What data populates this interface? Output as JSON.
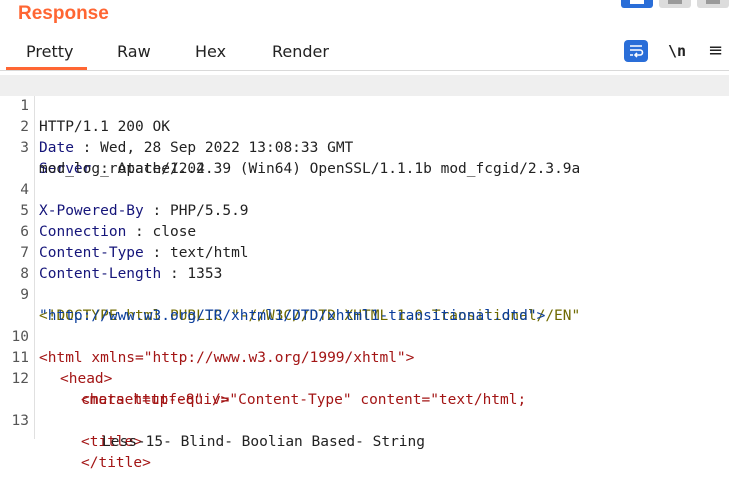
{
  "panel": {
    "title": "Response"
  },
  "tabs": [
    "Pretty",
    "Raw",
    "Hex",
    "Render"
  ],
  "toolbar": {
    "newline_label": "\\n",
    "menu_label": "≡"
  },
  "lines": [
    {
      "num": "1",
      "text": "HTTP/1.1 200 OK"
    },
    {
      "num": "2",
      "key": "Date",
      "value": "Wed, 28 Sep 2022 13:08:33 GMT"
    },
    {
      "num": "3",
      "key": "Server",
      "value": "Apache/2.4.39 (Win64) OpenSSL/1.1.1b mod_fcgid/2.3.9a",
      "cont": "mod_log_rotate/1.02"
    },
    {
      "num": "4",
      "key": "X-Powered-By",
      "value": "PHP/5.5.9"
    },
    {
      "num": "5",
      "key": "Connection",
      "value": "close"
    },
    {
      "num": "6",
      "key": "Content-Type",
      "value": "text/html"
    },
    {
      "num": "7",
      "key": "Content-Length",
      "value": "1353"
    },
    {
      "num": "8",
      "text": ""
    },
    {
      "num": "9",
      "text": "<!DOCTYPE html PUBLIC \"-//W3C//DTD XHTML 1.0 Transitional//EN\"",
      "cont": "\"http://www.w3.org/TR/xhtml1/DTD/xhtml1-transitional.dtd\">"
    },
    {
      "num": "10",
      "text": "<html xmlns=\"http://www.w3.org/1999/xhtml\">"
    },
    {
      "num": "11",
      "text": "<head>"
    },
    {
      "num": "12",
      "text": "<meta http-equiv=\"Content-Type\" content=\"text/html;",
      "cont": "charset=utf-8\" />"
    },
    {
      "num": "13",
      "text": "<title>",
      "cont": "Less-15- Blind- Boolian Based- String"
    },
    {
      "num": "",
      "text": "</title>"
    }
  ]
}
